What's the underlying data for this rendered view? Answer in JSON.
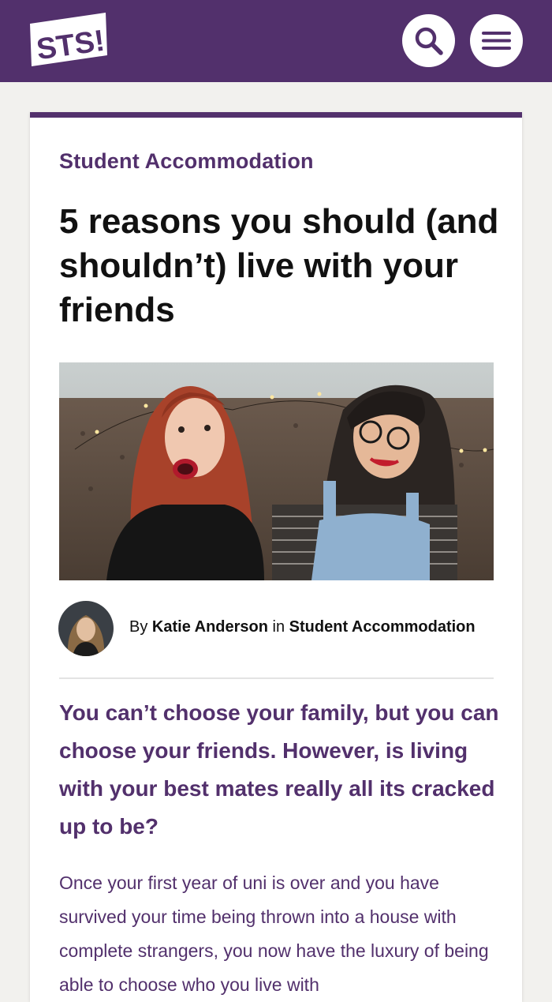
{
  "header": {
    "logo_text": "STS!",
    "search_icon": "search-icon",
    "menu_icon": "hamburger-menu-icon",
    "background_color": "#52306c"
  },
  "article": {
    "category": "Student Accommodation",
    "title": "5 reasons you should (and shouldn’t) live with your friends",
    "hero_image": "photo-two-friends-smiling-on-sofa",
    "byline": {
      "prefix": "By",
      "author": "Katie Anderson",
      "connector": "in",
      "section": "Student Accommodation"
    },
    "intro": "You can’t choose your family, but you can choose your friends. However, is living with your best mates really all its cracked up to be?",
    "body": "Once your first year of uni is over and you have survived your time being thrown into a house with complete strangers, you now have the luxury of being able to choose who you live with"
  },
  "colors": {
    "brand_purple": "#52306c",
    "page_background": "#f2f1ee",
    "text_dark": "#111111"
  }
}
